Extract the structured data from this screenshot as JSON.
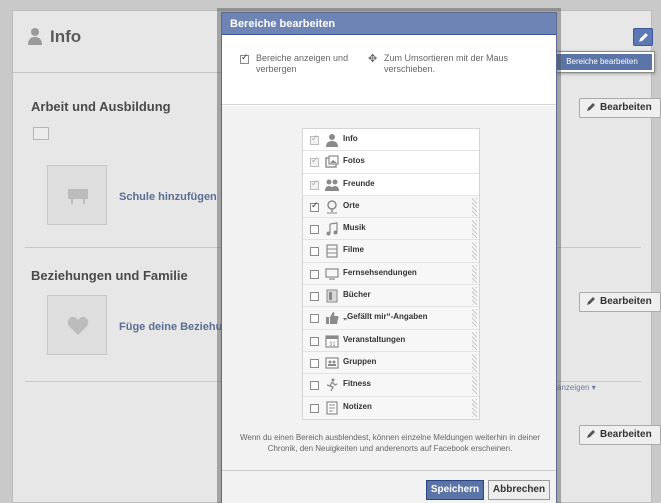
{
  "background": {
    "title": "Info",
    "sections": [
      {
        "title": "Arbeit und Ausbildung",
        "edit": "Bearbeiten",
        "link": "Schule hinzufügen"
      },
      {
        "title": "Beziehungen und Familie",
        "edit": "Bearbeiten",
        "link": "Füge deine Beziehung"
      },
      {
        "edit": "Bearbeiten"
      }
    ],
    "anzeigen": "anzeigen ▾"
  },
  "dropdown": {
    "item": "Bereiche bearbeiten"
  },
  "modal": {
    "title": "Bereiche bearbeiten",
    "option_show_hide": "Bereiche anzeigen und verbergen",
    "option_sort": "Zum Umsortieren mit der Maus verschieben.",
    "sections": [
      {
        "label": "Info",
        "icon": "person-icon",
        "checked": true,
        "locked": true
      },
      {
        "label": "Fotos",
        "icon": "photos-icon",
        "checked": true,
        "locked": true
      },
      {
        "label": "Freunde",
        "icon": "friends-icon",
        "checked": true,
        "locked": true
      },
      {
        "label": "Orte",
        "icon": "map-pin-icon",
        "checked": true,
        "locked": false
      },
      {
        "label": "Musik",
        "icon": "music-note-icon",
        "checked": false,
        "locked": false
      },
      {
        "label": "Filme",
        "icon": "film-icon",
        "checked": false,
        "locked": false
      },
      {
        "label": "Fernsehsendungen",
        "icon": "tv-icon",
        "checked": false,
        "locked": false
      },
      {
        "label": "Bücher",
        "icon": "book-icon",
        "checked": false,
        "locked": false
      },
      {
        "label": "„Gefällt mir“-Angaben",
        "icon": "thumbs-up-icon",
        "checked": false,
        "locked": false
      },
      {
        "label": "Veranstaltungen",
        "icon": "calendar-icon",
        "checked": false,
        "locked": false
      },
      {
        "label": "Gruppen",
        "icon": "groups-icon",
        "checked": false,
        "locked": false
      },
      {
        "label": "Fitness",
        "icon": "running-icon",
        "checked": false,
        "locked": false
      },
      {
        "label": "Notizen",
        "icon": "notes-icon",
        "checked": false,
        "locked": false
      }
    ],
    "note": "Wenn du einen Bereich ausblendest, können einzelne Meldungen weiterhin in deiner Chronik, den Neuigkeiten und anderenorts auf Facebook erscheinen.",
    "save": "Speichern",
    "cancel": "Abbrechen"
  }
}
